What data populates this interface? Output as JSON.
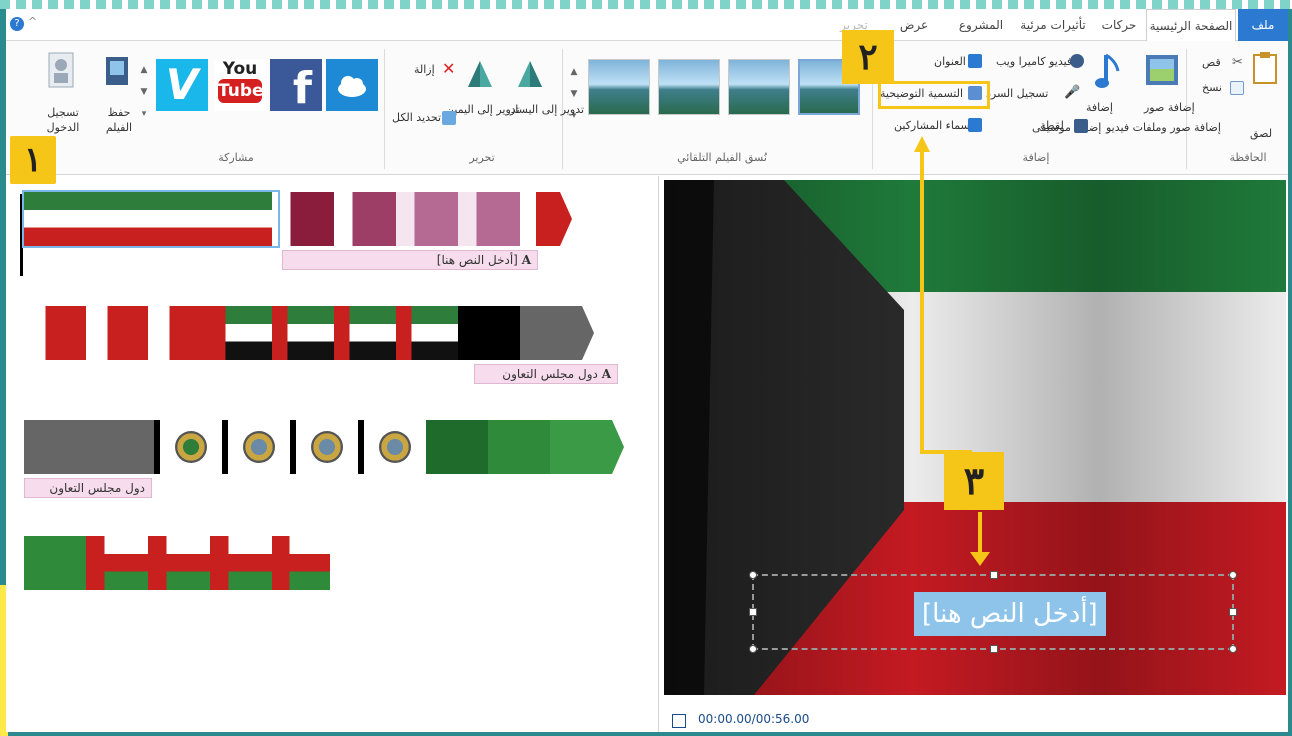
{
  "tabs": [
    "ملف",
    "الصفحة الرئيسية",
    "حركات",
    "تأثيرات مرئية",
    "المشروع",
    "عرض",
    "تحرير"
  ],
  "ribbon": {
    "clipboard": {
      "paste": "لصق",
      "cut": "قص",
      "copy": "نسخ",
      "group": "الحافظة"
    },
    "add": {
      "add_photos_videos": "إضافة صور وملفات فيديو",
      "add_music": "إضافة موسيقى",
      "webcam_video": "فيديو كاميرا ويب",
      "record_narration": "تسجيل السرد",
      "snapshot": "لقطة",
      "title": "العنوان",
      "caption": "التسمية التوضيحية",
      "credits": "أسماء المشاركين",
      "group": "إضافة"
    },
    "themes": {
      "group": "نُسق الفيلم التلقائي"
    },
    "editing": {
      "remove": "إزالة",
      "rotate_left": "تدوير إلى اليسار",
      "rotate_right": "تدوير إلى اليمين",
      "select_all": "تحديد الكل",
      "group": "تحرير"
    },
    "share": {
      "group": "مشاركة",
      "youtube_top": "You",
      "youtube_bottom": "Tube",
      "facebook": "f",
      "vimeo": "V"
    },
    "save_movie": "حفظ الفيلم",
    "sign_in": "تسجيل الدخول"
  },
  "storyboard": {
    "caption_1": "[أدخل النص هنا]",
    "caption_2": "دول مجلس التعاون",
    "caption_3": "دول مجلس التعاون"
  },
  "preview": {
    "caption_text": "[أدخل النص هنا]",
    "timecode": "00:00.00/00:56.00"
  },
  "badges": {
    "one": "١",
    "two": "٢",
    "three": "٣"
  },
  "colors": {
    "file_tab": "#2b79d0",
    "badge": "#f5c518",
    "highlight": "#f5c518"
  }
}
